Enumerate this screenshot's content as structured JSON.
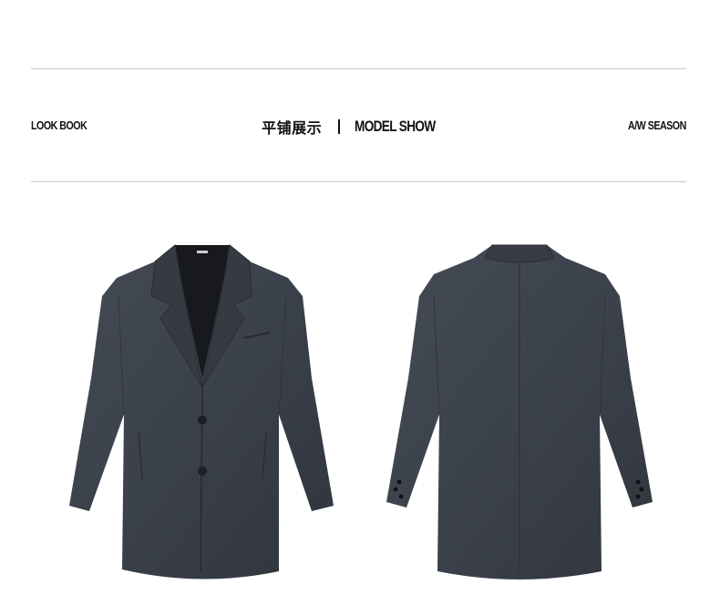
{
  "header": {
    "left_label": "LOOK BOOK",
    "center_cn_title": "平铺展示",
    "center_en_title": "MODEL SHOW",
    "right_label": "A/W SEASON"
  },
  "colors": {
    "coat_main": "#3b414b",
    "coat_dark": "#2b3038",
    "lining": "#18191c",
    "rule": "#c9c9c9",
    "text": "#111111"
  },
  "products": [
    {
      "name": "coat-front-view",
      "view": "front"
    },
    {
      "name": "coat-back-view",
      "view": "back"
    }
  ]
}
